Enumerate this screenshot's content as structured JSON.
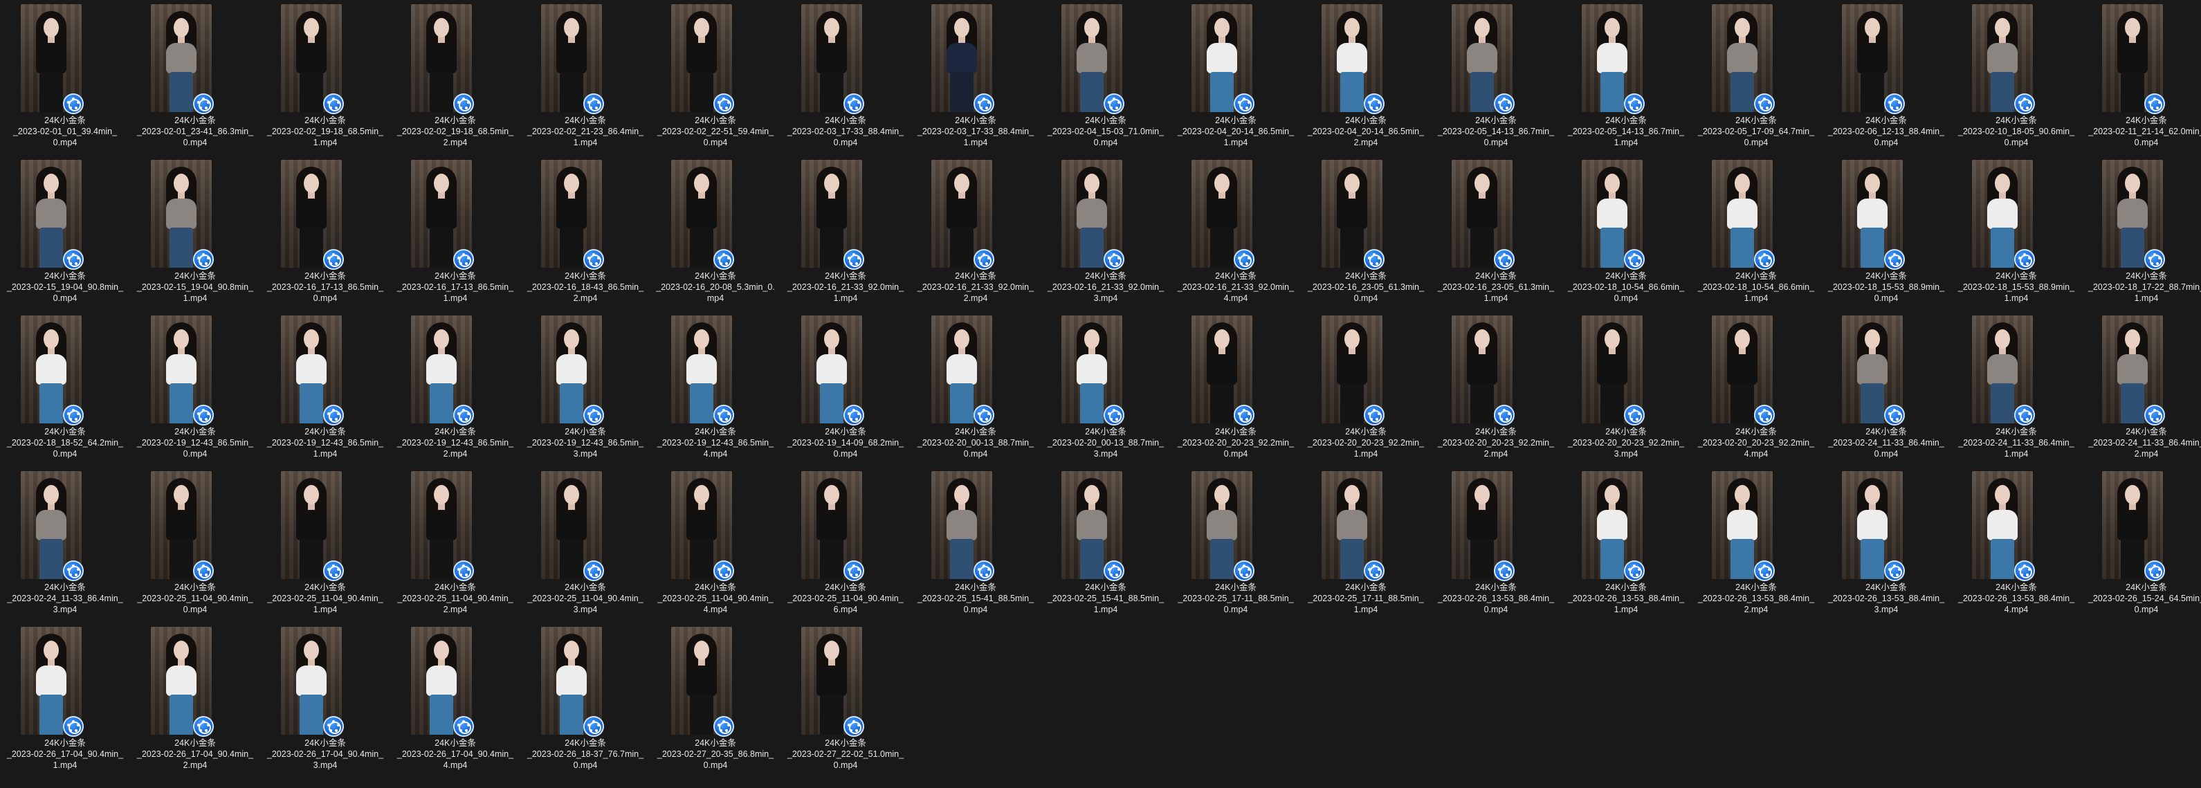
{
  "colors": {
    "background": "#191919",
    "text": "#e8e8e8",
    "badge": "#1566d6"
  },
  "badge_icon": "video-player-icon",
  "files": [
    {
      "name": "24K小金条",
      "l2": "_2023-02-01_01_39.4min_",
      "l3": "0.mp4",
      "top": "black"
    },
    {
      "name": "24K小金条",
      "l2": "_2023-02-01_23-41_86.3min_",
      "l3": "0.mp4",
      "top": "grey"
    },
    {
      "name": "24K小金条",
      "l2": "_2023-02-02_19-18_68.5min_",
      "l3": "1.mp4",
      "top": "black"
    },
    {
      "name": "24K小金条",
      "l2": "_2023-02-02_19-18_68.5min_",
      "l3": "2.mp4",
      "top": "black"
    },
    {
      "name": "24K小金条",
      "l2": "_2023-02-02_21-23_86.4min_",
      "l3": "1.mp4",
      "top": "black"
    },
    {
      "name": "24K小金条",
      "l2": "_2023-02-02_22-51_59.4min_",
      "l3": "0.mp4",
      "top": "black"
    },
    {
      "name": "24K小金条",
      "l2": "_2023-02-03_17-33_88.4min_",
      "l3": "0.mp4",
      "top": "black"
    },
    {
      "name": "24K小金条",
      "l2": "_2023-02-03_17-33_88.4min_",
      "l3": "1.mp4",
      "top": "navy"
    },
    {
      "name": "24K小金条",
      "l2": "_2023-02-04_15-03_71.0min_",
      "l3": "0.mp4",
      "top": "grey"
    },
    {
      "name": "24K小金条",
      "l2": "_2023-02-04_20-14_86.5min_",
      "l3": "1.mp4",
      "top": "white"
    },
    {
      "name": "24K小金条",
      "l2": "_2023-02-04_20-14_86.5min_",
      "l3": "2.mp4",
      "top": "white"
    },
    {
      "name": "24K小金条",
      "l2": "_2023-02-05_14-13_86.7min_",
      "l3": "0.mp4",
      "top": "grey"
    },
    {
      "name": "24K小金条",
      "l2": "_2023-02-05_14-13_86.7min_",
      "l3": "1.mp4",
      "top": "white"
    },
    {
      "name": "24K小金条",
      "l2": "_2023-02-05_17-09_64.7min_",
      "l3": "0.mp4",
      "top": "grey"
    },
    {
      "name": "24K小金条",
      "l2": "_2023-02-06_12-13_88.4min_",
      "l3": "0.mp4",
      "top": "black"
    },
    {
      "name": "24K小金条",
      "l2": "_2023-02-10_18-05_90.6min_",
      "l3": "0.mp4",
      "top": "grey"
    },
    {
      "name": "24K小金条",
      "l2": "_2023-02-11_21-14_62.0min_",
      "l3": "0.mp4",
      "top": "black"
    },
    {
      "name": "24K小金条",
      "l2": "_2023-02-15_19-04_90.8min_",
      "l3": "0.mp4",
      "top": "grey"
    },
    {
      "name": "24K小金条",
      "l2": "_2023-02-15_19-04_90.8min_",
      "l3": "1.mp4",
      "top": "grey"
    },
    {
      "name": "24K小金条",
      "l2": "_2023-02-16_17-13_86.5min_",
      "l3": "0.mp4",
      "top": "black"
    },
    {
      "name": "24K小金条",
      "l2": "_2023-02-16_17-13_86.5min_",
      "l3": "1.mp4",
      "top": "black"
    },
    {
      "name": "24K小金条",
      "l2": "_2023-02-16_18-43_86.5min_",
      "l3": "2.mp4",
      "top": "black"
    },
    {
      "name": "24K小金条",
      "l2": "_2023-02-16_20-08_5.3min_0.",
      "l3": "mp4",
      "top": "black"
    },
    {
      "name": "24K小金条",
      "l2": "_2023-02-16_21-33_92.0min_",
      "l3": "1.mp4",
      "top": "black"
    },
    {
      "name": "24K小金条",
      "l2": "_2023-02-16_21-33_92.0min_",
      "l3": "2.mp4",
      "top": "black"
    },
    {
      "name": "24K小金条",
      "l2": "_2023-02-16_21-33_92.0min_",
      "l3": "3.mp4",
      "top": "grey"
    },
    {
      "name": "24K小金条",
      "l2": "_2023-02-16_21-33_92.0min_",
      "l3": "4.mp4",
      "top": "black"
    },
    {
      "name": "24K小金条",
      "l2": "_2023-02-16_23-05_61.3min_",
      "l3": "0.mp4",
      "top": "black"
    },
    {
      "name": "24K小金条",
      "l2": "_2023-02-16_23-05_61.3min_",
      "l3": "1.mp4",
      "top": "black"
    },
    {
      "name": "24K小金条",
      "l2": "_2023-02-18_10-54_86.6min_",
      "l3": "0.mp4",
      "top": "white"
    },
    {
      "name": "24K小金条",
      "l2": "_2023-02-18_10-54_86.6min_",
      "l3": "1.mp4",
      "top": "white"
    },
    {
      "name": "24K小金条",
      "l2": "_2023-02-18_15-53_88.9min_",
      "l3": "0.mp4",
      "top": "white"
    },
    {
      "name": "24K小金条",
      "l2": "_2023-02-18_15-53_88.9min_",
      "l3": "1.mp4",
      "top": "white"
    },
    {
      "name": "24K小金条",
      "l2": "_2023-02-18_17-22_88.7min_",
      "l3": "1.mp4",
      "top": "grey"
    },
    {
      "name": "24K小金条",
      "l2": "_2023-02-18_18-52_64.2min_",
      "l3": "0.mp4",
      "top": "white"
    },
    {
      "name": "24K小金条",
      "l2": "_2023-02-19_12-43_86.5min_",
      "l3": "0.mp4",
      "top": "white"
    },
    {
      "name": "24K小金条",
      "l2": "_2023-02-19_12-43_86.5min_",
      "l3": "1.mp4",
      "top": "white"
    },
    {
      "name": "24K小金条",
      "l2": "_2023-02-19_12-43_86.5min_",
      "l3": "2.mp4",
      "top": "white"
    },
    {
      "name": "24K小金条",
      "l2": "_2023-02-19_12-43_86.5min_",
      "l3": "3.mp4",
      "top": "white"
    },
    {
      "name": "24K小金条",
      "l2": "_2023-02-19_12-43_86.5min_",
      "l3": "4.mp4",
      "top": "white"
    },
    {
      "name": "24K小金条",
      "l2": "_2023-02-19_14-09_68.2min_",
      "l3": "0.mp4",
      "top": "white"
    },
    {
      "name": "24K小金条",
      "l2": "_2023-02-20_00-13_88.7min_",
      "l3": "0.mp4",
      "top": "white"
    },
    {
      "name": "24K小金条",
      "l2": "_2023-02-20_00-13_88.7min_",
      "l3": "3.mp4",
      "top": "white"
    },
    {
      "name": "24K小金条",
      "l2": "_2023-02-20_20-23_92.2min_",
      "l3": "0.mp4",
      "top": "black"
    },
    {
      "name": "24K小金条",
      "l2": "_2023-02-20_20-23_92.2min_",
      "l3": "1.mp4",
      "top": "black"
    },
    {
      "name": "24K小金条",
      "l2": "_2023-02-20_20-23_92.2min_",
      "l3": "2.mp4",
      "top": "black"
    },
    {
      "name": "24K小金条",
      "l2": "_2023-02-20_20-23_92.2min_",
      "l3": "3.mp4",
      "top": "black"
    },
    {
      "name": "24K小金条",
      "l2": "_2023-02-20_20-23_92.2min_",
      "l3": "4.mp4",
      "top": "black"
    },
    {
      "name": "24K小金条",
      "l2": "_2023-02-24_11-33_86.4min_",
      "l3": "0.mp4",
      "top": "grey"
    },
    {
      "name": "24K小金条",
      "l2": "_2023-02-24_11-33_86.4min_",
      "l3": "1.mp4",
      "top": "grey"
    },
    {
      "name": "24K小金条",
      "l2": "_2023-02-24_11-33_86.4min_",
      "l3": "2.mp4",
      "top": "grey"
    },
    {
      "name": "24K小金条",
      "l2": "_2023-02-24_11-33_86.4min_",
      "l3": "3.mp4",
      "top": "grey"
    },
    {
      "name": "24K小金条",
      "l2": "_2023-02-25_11-04_90.4min_",
      "l3": "0.mp4",
      "top": "black"
    },
    {
      "name": "24K小金条",
      "l2": "_2023-02-25_11-04_90.4min_",
      "l3": "1.mp4",
      "top": "black"
    },
    {
      "name": "24K小金条",
      "l2": "_2023-02-25_11-04_90.4min_",
      "l3": "2.mp4",
      "top": "black"
    },
    {
      "name": "24K小金条",
      "l2": "_2023-02-25_11-04_90.4min_",
      "l3": "3.mp4",
      "top": "black"
    },
    {
      "name": "24K小金条",
      "l2": "_2023-02-25_11-04_90.4min_",
      "l3": "4.mp4",
      "top": "black"
    },
    {
      "name": "24K小金条",
      "l2": "_2023-02-25_11-04_90.4min_",
      "l3": "6.mp4",
      "top": "black"
    },
    {
      "name": "24K小金条",
      "l2": "_2023-02-25_15-41_88.5min_",
      "l3": "0.mp4",
      "top": "grey"
    },
    {
      "name": "24K小金条",
      "l2": "_2023-02-25_15-41_88.5min_",
      "l3": "1.mp4",
      "top": "grey"
    },
    {
      "name": "24K小金条",
      "l2": "_2023-02-25_17-11_88.5min_",
      "l3": "0.mp4",
      "top": "grey"
    },
    {
      "name": "24K小金条",
      "l2": "_2023-02-25_17-11_88.5min_",
      "l3": "1.mp4",
      "top": "grey"
    },
    {
      "name": "24K小金条",
      "l2": "_2023-02-26_13-53_88.4min_",
      "l3": "0.mp4",
      "top": "black"
    },
    {
      "name": "24K小金条",
      "l2": "_2023-02-26_13-53_88.4min_",
      "l3": "1.mp4",
      "top": "white"
    },
    {
      "name": "24K小金条",
      "l2": "_2023-02-26_13-53_88.4min_",
      "l3": "2.mp4",
      "top": "white"
    },
    {
      "name": "24K小金条",
      "l2": "_2023-02-26_13-53_88.4min_",
      "l3": "3.mp4",
      "top": "white"
    },
    {
      "name": "24K小金条",
      "l2": "_2023-02-26_13-53_88.4min_",
      "l3": "4.mp4",
      "top": "white"
    },
    {
      "name": "24K小金条",
      "l2": "_2023-02-26_15-24_64.5min_",
      "l3": "0.mp4",
      "top": "black"
    },
    {
      "name": "24K小金条",
      "l2": "_2023-02-26_17-04_90.4min_",
      "l3": "1.mp4",
      "top": "white"
    },
    {
      "name": "24K小金条",
      "l2": "_2023-02-26_17-04_90.4min_",
      "l3": "2.mp4",
      "top": "white"
    },
    {
      "name": "24K小金条",
      "l2": "_2023-02-26_17-04_90.4min_",
      "l3": "3.mp4",
      "top": "white"
    },
    {
      "name": "24K小金条",
      "l2": "_2023-02-26_17-04_90.4min_",
      "l3": "4.mp4",
      "top": "white"
    },
    {
      "name": "24K小金条",
      "l2": "_2023-02-26_18-37_76.7min_",
      "l3": "0.mp4",
      "top": "white"
    },
    {
      "name": "24K小金条",
      "l2": "_2023-02-27_20-35_86.8min_",
      "l3": "0.mp4",
      "top": "black"
    },
    {
      "name": "24K小金条",
      "l2": "_2023-02-27_22-02_51.0min_",
      "l3": "0.mp4",
      "top": "black"
    }
  ]
}
